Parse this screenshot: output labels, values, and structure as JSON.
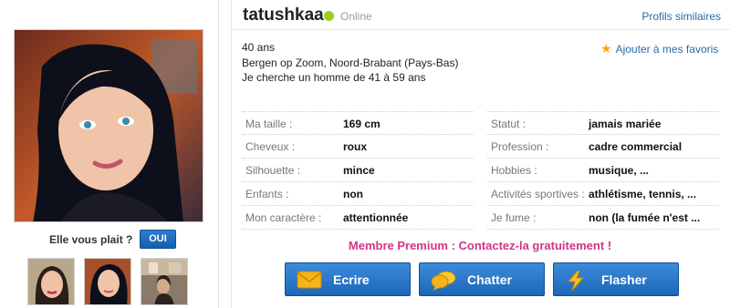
{
  "profile": {
    "username": "tatushkaa",
    "status": "Online",
    "similar_link": "Profils similaires",
    "favorites_label": "Ajouter à mes favoris",
    "age": "40 ans",
    "location": "Bergen op Zoom, Noord-Brabant (Pays-Bas)",
    "seeking": "Je cherche un homme de 41 à 59 ans"
  },
  "like": {
    "question": "Elle vous plait ?",
    "button": "OUI"
  },
  "details_left": [
    {
      "label": "Ma taille :",
      "value": "169 cm"
    },
    {
      "label": "Cheveux :",
      "value": "roux"
    },
    {
      "label": "Silhouette :",
      "value": "mince"
    },
    {
      "label": "Enfants :",
      "value": "non"
    },
    {
      "label": "Mon caractère :",
      "value": "attentionnée"
    }
  ],
  "details_right": [
    {
      "label": "Statut :",
      "value": "jamais mariée"
    },
    {
      "label": "Profession :",
      "value": "cadre commercial"
    },
    {
      "label": "Hobbies :",
      "value": "musique, ..."
    },
    {
      "label": "Activités sportives :",
      "value": "athlétisme, tennis, ..."
    },
    {
      "label": "Je fume :",
      "value": "non (la fumée n'est ..."
    }
  ],
  "premium_text": "Membre Premium : Contactez-la gratuitement !",
  "actions": {
    "write": "Ecrire",
    "chat": "Chatter",
    "flash": "Flasher"
  },
  "colors": {
    "online": "#9bcf1f",
    "link": "#2a6aa8",
    "premium": "#d4338a",
    "button": "#1d66b8",
    "star": "#f4a814"
  }
}
